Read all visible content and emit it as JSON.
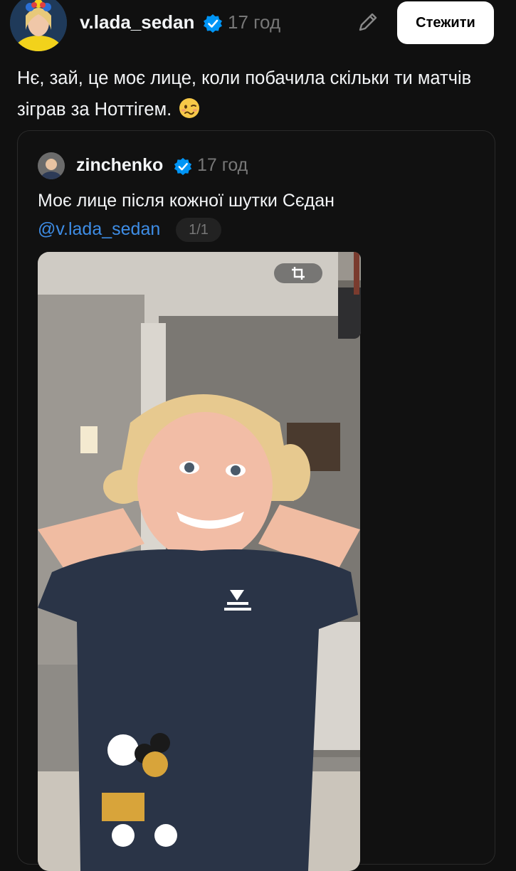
{
  "post": {
    "username": "v.lada_sedan",
    "time": "17 год",
    "follow_label": "Стежити",
    "text": "Нє, зай, це моє лице, коли побачила скільки ти матчів  зіграв за Ноттігем.",
    "emoji": "woozy-face"
  },
  "quote": {
    "username": "zinchenko",
    "time": "17 год",
    "text": "Моє лице після кожної шутки Сєдан",
    "mention": "@v.lada_sedan",
    "media_counter": "1/1"
  },
  "icons": {
    "verified": "verified-badge-icon",
    "edit": "pencil-icon",
    "crop": "crop-icon"
  },
  "colors": {
    "background": "#101010",
    "verified": "#0095f6",
    "mention": "#3e8de6",
    "muted": "#777777"
  }
}
